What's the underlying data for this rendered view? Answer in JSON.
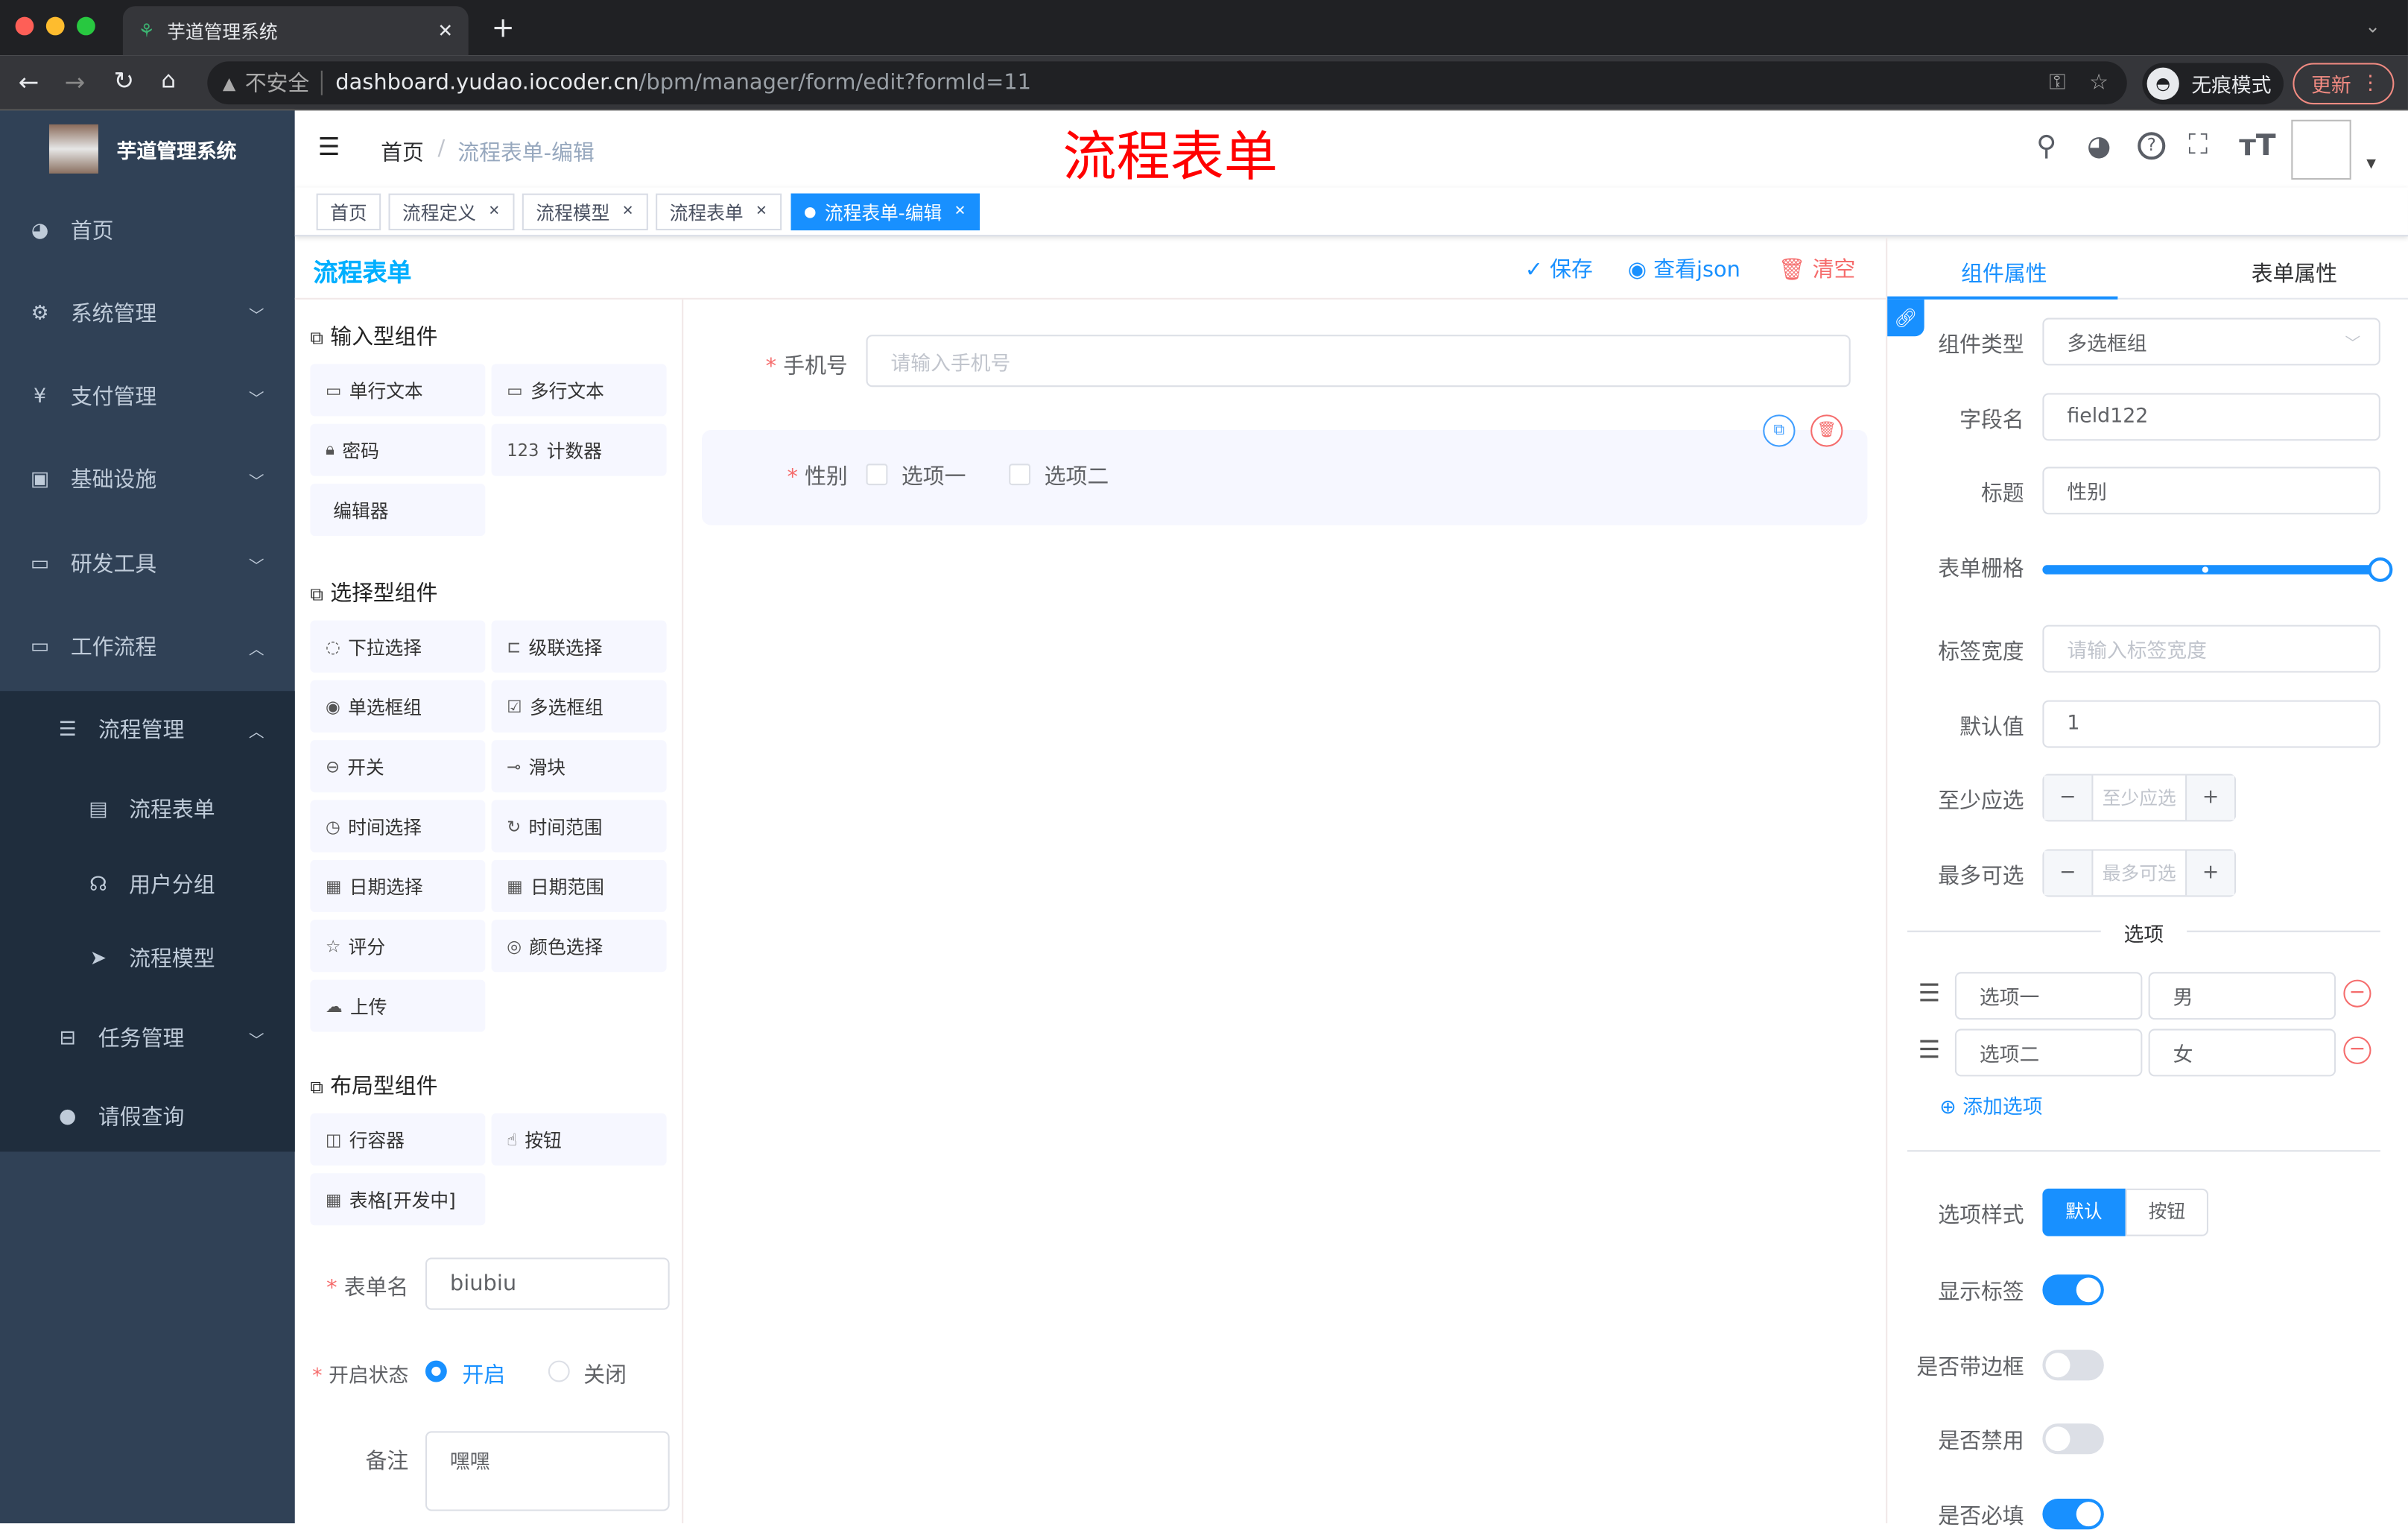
{
  "browser": {
    "tab_title": "芋道管理系统",
    "insecure": "不安全",
    "url_host": "dashboard.yudao.iocoder.cn",
    "url_path": "/bpm/manager/form/edit?formId=11",
    "incognito": "无痕模式",
    "update": "更新"
  },
  "sidebar": {
    "logo_title": "芋道管理系统",
    "items": [
      {
        "label": "首页",
        "icon": "dashboard-icon",
        "glyph": "◕",
        "arrow": ""
      },
      {
        "label": "系统管理",
        "icon": "gear-icon",
        "glyph": "⚙",
        "arrow": "﹀"
      },
      {
        "label": "支付管理",
        "icon": "yen-icon",
        "glyph": "¥",
        "arrow": "﹀"
      },
      {
        "label": "基础设施",
        "icon": "monitor-icon",
        "glyph": "▣",
        "arrow": "﹀"
      },
      {
        "label": "研发工具",
        "icon": "toolbox-icon",
        "glyph": "▭",
        "arrow": "﹀"
      },
      {
        "label": "工作流程",
        "icon": "toolbox-icon",
        "glyph": "▭",
        "arrow": "︿"
      }
    ],
    "sub_items": [
      {
        "label": "流程管理",
        "icon": "tree-list-icon",
        "glyph": "☰",
        "arrow": "︿",
        "indent": 1
      },
      {
        "label": "流程表单",
        "icon": "form-icon",
        "glyph": "▤",
        "arrow": "",
        "indent": 2
      },
      {
        "label": "用户分组",
        "icon": "user-group-icon",
        "glyph": "☊",
        "arrow": "",
        "indent": 2
      },
      {
        "label": "流程模型",
        "icon": "send-icon",
        "glyph": "➤",
        "arrow": "",
        "indent": 2
      },
      {
        "label": "任务管理",
        "icon": "tree-icon",
        "glyph": "⊟",
        "arrow": "﹀",
        "indent": 1
      },
      {
        "label": "请假查询",
        "icon": "user-icon",
        "glyph": "●",
        "arrow": "",
        "indent": 1
      }
    ]
  },
  "navbar": {
    "breadcrumb_home": "首页",
    "breadcrumb_current": "流程表单-编辑",
    "overlay_title": "流程表单"
  },
  "tags": [
    {
      "label": "首页",
      "closable": false
    },
    {
      "label": "流程定义",
      "closable": true
    },
    {
      "label": "流程模型",
      "closable": true
    },
    {
      "label": "流程表单",
      "closable": true
    },
    {
      "label": "流程表单-编辑",
      "closable": true,
      "active": true
    }
  ],
  "builder": {
    "logo": "流程表单",
    "save": "保存",
    "view_json": "查看json",
    "clear": "清空",
    "groups": [
      {
        "title": "输入型组件",
        "items": [
          {
            "label": "单行文本",
            "glyph": "▭"
          },
          {
            "label": "多行文本",
            "glyph": "▭"
          },
          {
            "label": "密码",
            "glyph": "🔒︎"
          },
          {
            "label": "计数器",
            "glyph": "123"
          },
          {
            "label": "编辑器",
            "glyph": ""
          }
        ]
      },
      {
        "title": "选择型组件",
        "items": [
          {
            "label": "下拉选择",
            "glyph": "◌"
          },
          {
            "label": "级联选择",
            "glyph": "⊏"
          },
          {
            "label": "单选框组",
            "glyph": "◉"
          },
          {
            "label": "多选框组",
            "glyph": "☑"
          },
          {
            "label": "开关",
            "glyph": "⊖"
          },
          {
            "label": "滑块",
            "glyph": "⊸"
          },
          {
            "label": "时间选择",
            "glyph": "◷"
          },
          {
            "label": "时间范围",
            "glyph": "↻"
          },
          {
            "label": "日期选择",
            "glyph": "▦"
          },
          {
            "label": "日期范围",
            "glyph": "▦"
          },
          {
            "label": "评分",
            "glyph": "☆"
          },
          {
            "label": "颜色选择",
            "glyph": "◎"
          },
          {
            "label": "上传",
            "glyph": "☁"
          }
        ]
      },
      {
        "title": "布局型组件",
        "items": [
          {
            "label": "行容器",
            "glyph": "◫"
          },
          {
            "label": "按钮",
            "glyph": "☝"
          },
          {
            "label": "表格[开发中]",
            "glyph": "▦"
          }
        ]
      }
    ],
    "form_name_label": "表单名",
    "form_name_value": "biubiu",
    "status_label": "开启状态",
    "status_on": "开启",
    "status_off": "关闭",
    "status_value": "开启",
    "remark_label": "备注",
    "remark_value": "嘿嘿"
  },
  "canvas": {
    "phone_label": "手机号",
    "phone_placeholder": "请输入手机号",
    "gender_label": "性别",
    "option1": "选项一",
    "option2": "选项二"
  },
  "props": {
    "tab_component": "组件属性",
    "tab_form": "表单属性",
    "type_label": "组件类型",
    "type_value": "多选框组",
    "field_label": "字段名",
    "field_value": "field122",
    "title_label": "标题",
    "title_value": "性别",
    "grid_label": "表单栅格",
    "grid_value": 24,
    "grid_max": 24,
    "label_width_label": "标签宽度",
    "label_width_placeholder": "请输入标签宽度",
    "default_label": "默认值",
    "default_value": "1",
    "min_label": "至少应选",
    "min_placeholder": "至少应选",
    "max_label": "最多可选",
    "max_placeholder": "最多可选",
    "options_divider": "选项",
    "options": [
      {
        "label": "选项一",
        "value": "男"
      },
      {
        "label": "选项二",
        "value": "女"
      }
    ],
    "add_option": "添加选项",
    "style_label": "选项样式",
    "style_default": "默认",
    "style_button": "按钮",
    "switches": [
      {
        "label": "显示标签",
        "on": true
      },
      {
        "label": "是否带边框",
        "on": false
      },
      {
        "label": "是否禁用",
        "on": false
      },
      {
        "label": "是否必填",
        "on": true
      }
    ]
  },
  "colors": {
    "primary": "#1890ff",
    "sidebar": "#304156",
    "submenu": "#1f2d3d",
    "danger": "#f56c6c",
    "title_red": "#ff0000"
  }
}
